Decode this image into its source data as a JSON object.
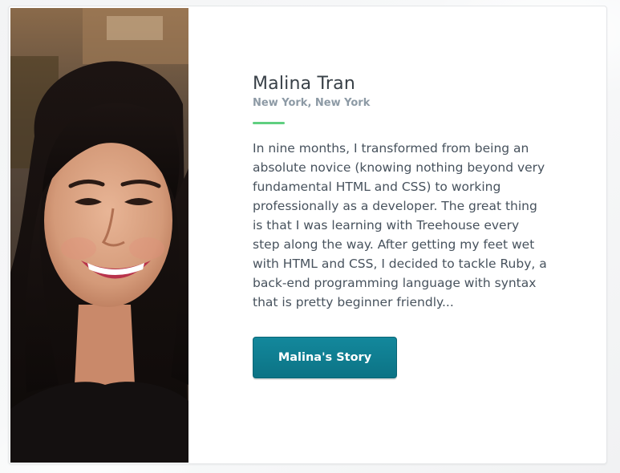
{
  "profile": {
    "name": "Malina Tran",
    "location": "New York, New York",
    "bio": "In nine months, I transformed from being an absolute novice (knowing nothing beyond very fundamental HTML and CSS) to working professionally as a developer. The great thing is that I was learning with Treehouse every step along the way. After getting my feet wet with HTML and CSS, I decided to tackle Ruby, a back-end programming language with syntax that is pretty beginner friendly...",
    "button_label": "Malina's Story"
  },
  "colors": {
    "accent_bar": "#5fcf80",
    "button": "#0e7c8f",
    "name_text": "#384047",
    "location_text": "#8d9aa5"
  }
}
